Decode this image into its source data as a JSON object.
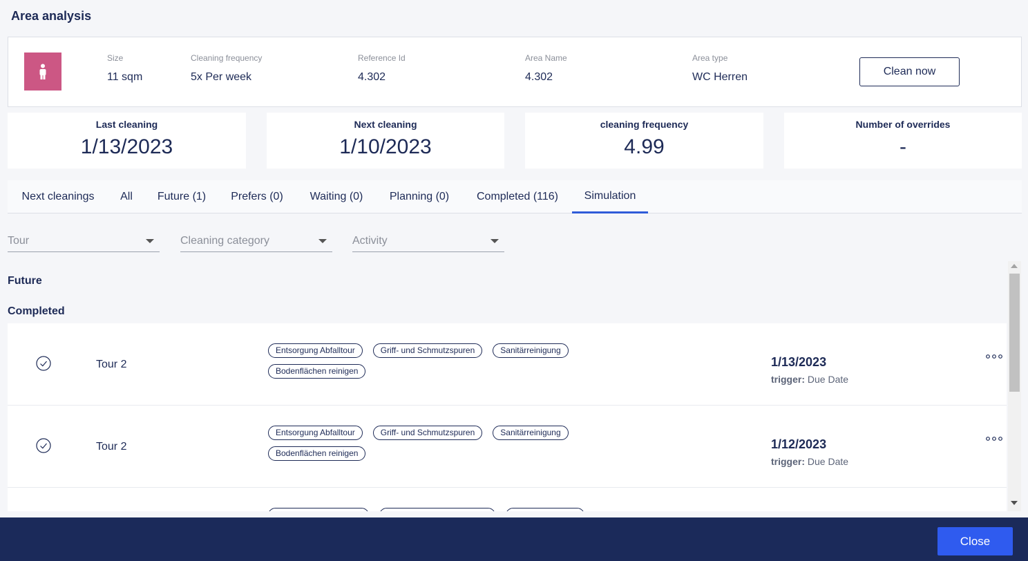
{
  "page": {
    "title": "Area analysis"
  },
  "info": {
    "icon": "person-icon",
    "icon_color": "#cc5784",
    "fields": [
      {
        "label": "Size",
        "value": "11 sqm"
      },
      {
        "label": "Cleaning frequency",
        "value": "5x Per week"
      },
      {
        "label": "Reference Id",
        "value": "4.302"
      },
      {
        "label": "Area Name",
        "value": "4.302"
      },
      {
        "label": "Area type",
        "value": "WC Herren"
      }
    ],
    "clean_now_label": "Clean now"
  },
  "stats": [
    {
      "label": "Last cleaning",
      "value": "1/13/2023"
    },
    {
      "label": "Next cleaning",
      "value": "1/10/2023"
    },
    {
      "label": "cleaning frequency",
      "value": "4.99"
    },
    {
      "label": "Number of overrides",
      "value": "-"
    }
  ],
  "tabs": [
    {
      "label": "Next cleanings"
    },
    {
      "label": "All"
    },
    {
      "label": "Future (1)"
    },
    {
      "label": "Prefers (0)"
    },
    {
      "label": "Waiting (0)"
    },
    {
      "label": "Planning (0)"
    },
    {
      "label": "Completed (116)"
    },
    {
      "label": "Simulation",
      "active": true
    }
  ],
  "filters": [
    {
      "placeholder": "Tour"
    },
    {
      "placeholder": "Cleaning category"
    },
    {
      "placeholder": "Activity"
    }
  ],
  "sections": {
    "future": "Future",
    "completed": "Completed"
  },
  "rows": [
    {
      "tour": "Tour 2",
      "tags": [
        "Entsorgung Abfalltour",
        "Griff- und Schmutzspuren",
        "Sanitärreinigung",
        "Bodenflächen reinigen"
      ],
      "date": "1/13/2023",
      "trigger_label": "trigger:",
      "trigger_value": "Due Date"
    },
    {
      "tour": "Tour 2",
      "tags": [
        "Entsorgung Abfalltour",
        "Griff- und Schmutzspuren",
        "Sanitärreinigung",
        "Bodenflächen reinigen"
      ],
      "date": "1/12/2023",
      "trigger_label": "trigger:",
      "trigger_value": "Due Date"
    },
    {
      "tour": "",
      "tags": [
        "",
        "",
        ""
      ],
      "date": "",
      "trigger_label": "",
      "trigger_value": ""
    }
  ],
  "colors": {
    "accent": "#2f5bef",
    "footer": "#1b2a5a",
    "text": "#1d2a56"
  },
  "footer": {
    "close_label": "Close"
  }
}
